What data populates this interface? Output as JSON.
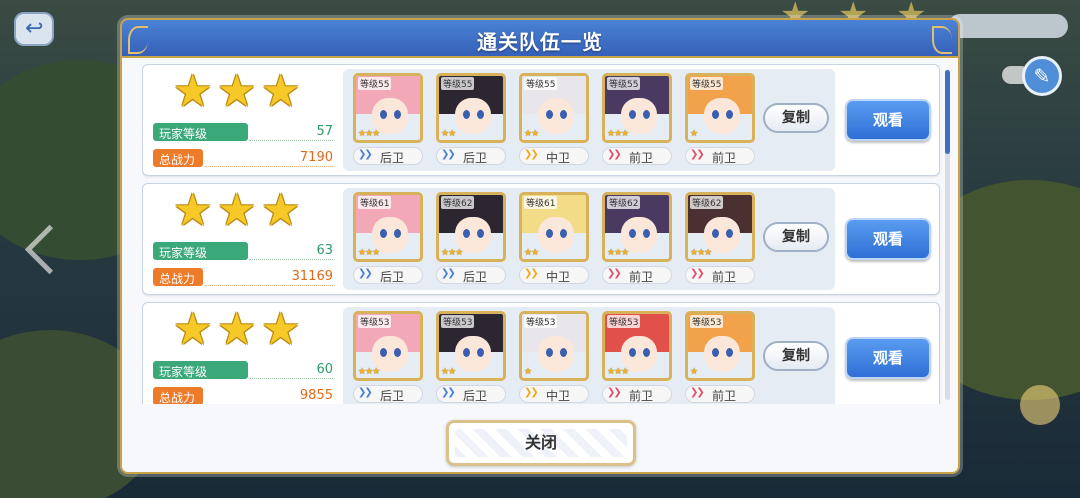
{
  "dialog": {
    "title": "通关队伍一览",
    "close_label": "关闭"
  },
  "labels": {
    "player_level": "玩家等级",
    "total_power": "总战力",
    "copy": "复制",
    "view": "观看"
  },
  "teams": [
    {
      "stars": 3,
      "player_level": "57",
      "total_power": "7190",
      "members": [
        {
          "level": "等级55",
          "position": "后卫",
          "hair": "#f3a8b8",
          "rank": "★★★"
        },
        {
          "level": "等级55",
          "position": "后卫",
          "hair": "#2c2630",
          "rank": "★★"
        },
        {
          "level": "等级55",
          "position": "中卫",
          "hair": "#e8e6ea",
          "rank": "★★"
        },
        {
          "level": "等级55",
          "position": "前卫",
          "hair": "#4a3a62",
          "rank": "★★★"
        },
        {
          "level": "等级55",
          "position": "前卫",
          "hair": "#f2a24a",
          "rank": "★"
        }
      ]
    },
    {
      "stars": 3,
      "player_level": "63",
      "total_power": "31169",
      "members": [
        {
          "level": "等级61",
          "position": "后卫",
          "hair": "#f3a8b8",
          "rank": "★★★"
        },
        {
          "level": "等级62",
          "position": "后卫",
          "hair": "#2c2630",
          "rank": "★★★"
        },
        {
          "level": "等级61",
          "position": "中卫",
          "hair": "#f2dc88",
          "rank": "★★"
        },
        {
          "level": "等级62",
          "position": "前卫",
          "hair": "#4a3a62",
          "rank": "★★★"
        },
        {
          "level": "等级62",
          "position": "前卫",
          "hair": "#4a3030",
          "rank": "★★★"
        }
      ]
    },
    {
      "stars": 3,
      "player_level": "60",
      "total_power": "9855",
      "members": [
        {
          "level": "等级53",
          "position": "后卫",
          "hair": "#f3a8b8",
          "rank": "★★★"
        },
        {
          "level": "等级53",
          "position": "后卫",
          "hair": "#2c2630",
          "rank": "★★"
        },
        {
          "level": "等级53",
          "position": "中卫",
          "hair": "#e8e6ea",
          "rank": "★"
        },
        {
          "level": "等级53",
          "position": "前卫",
          "hair": "#e2504a",
          "rank": "★★★"
        },
        {
          "level": "等级53",
          "position": "前卫",
          "hair": "#f2a24a",
          "rank": "★"
        }
      ]
    }
  ],
  "position_colors": {
    "后卫": "#4a7fd8",
    "中卫": "#f0a81c",
    "前卫": "#e0506a"
  },
  "colors": {
    "header": "#3561b8",
    "view_button": "#2f6fd6",
    "level_badge": "#3aa878",
    "power_badge": "#ee7b2a",
    "star": "#f7c928"
  }
}
